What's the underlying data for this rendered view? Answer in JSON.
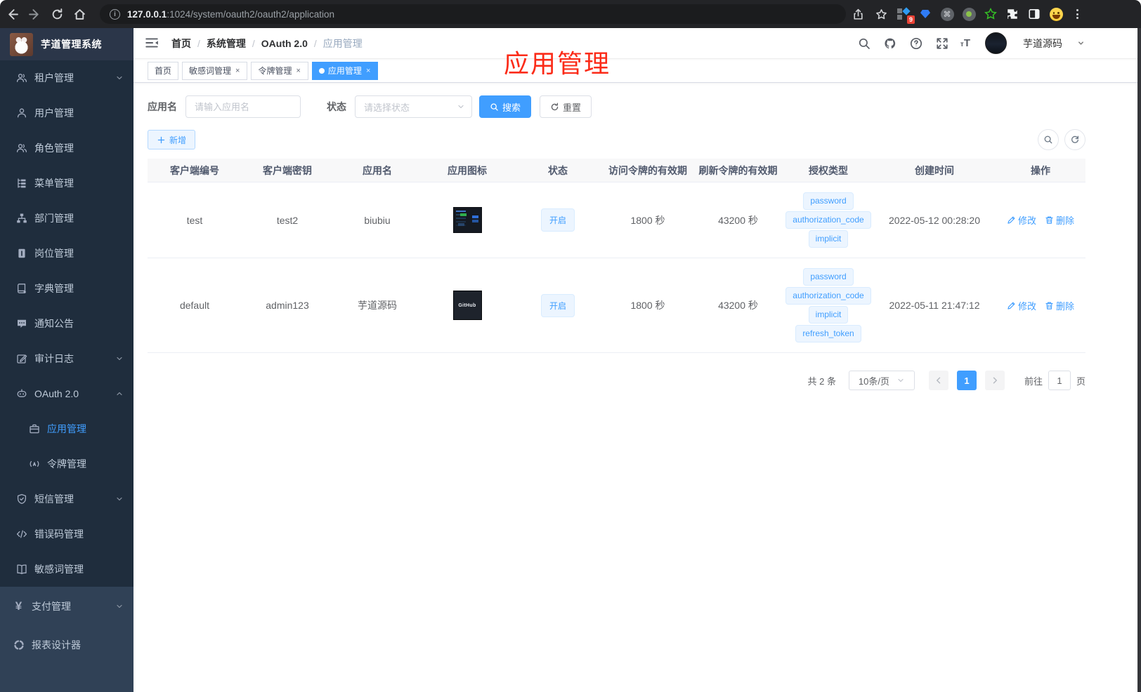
{
  "browser": {
    "url": {
      "host": "127.0.0.1",
      "rest": ":1024/system/oauth2/oauth2/application"
    },
    "extension_badge": "9"
  },
  "annotation": {
    "text": "应用管理"
  },
  "sidebar": {
    "title": "芋道管理系统",
    "groups": [
      {
        "id": "system",
        "items": [
          {
            "id": "tenant",
            "icon": "users",
            "label": "租户管理",
            "arrow": "down"
          },
          {
            "id": "user",
            "icon": "user",
            "label": "用户管理"
          },
          {
            "id": "role",
            "icon": "users",
            "label": "角色管理"
          },
          {
            "id": "menu",
            "icon": "tree",
            "label": "菜单管理"
          },
          {
            "id": "dept",
            "icon": "org",
            "label": "部门管理"
          },
          {
            "id": "post",
            "icon": "badge",
            "label": "岗位管理"
          },
          {
            "id": "dict",
            "icon": "dict",
            "label": "字典管理"
          },
          {
            "id": "notice",
            "icon": "message",
            "label": "通知公告"
          },
          {
            "id": "audit",
            "icon": "edit",
            "label": "审计日志",
            "arrow": "down"
          },
          {
            "id": "oauth2",
            "icon": "robot",
            "label": "OAuth 2.0",
            "arrow": "up"
          },
          {
            "id": "oauth2-app",
            "icon": "briefcase",
            "label": "应用管理",
            "indent": true,
            "active": true
          },
          {
            "id": "oauth2-token",
            "icon": "signal",
            "label": "令牌管理",
            "indent": true
          },
          {
            "id": "sms",
            "icon": "shield",
            "label": "短信管理",
            "arrow": "down"
          },
          {
            "id": "errcode",
            "icon": "code",
            "label": "错误码管理"
          },
          {
            "id": "sensitive",
            "icon": "book",
            "label": "敏感词管理"
          }
        ]
      },
      {
        "id": "root",
        "root": true,
        "items": [
          {
            "id": "pay",
            "icon": "yen",
            "label": "支付管理",
            "arrow": "down"
          },
          {
            "id": "report",
            "icon": "target",
            "label": "报表设计器"
          }
        ]
      }
    ]
  },
  "header": {
    "breadcrumb": [
      "首页",
      "系统管理",
      "OAuth 2.0",
      "应用管理"
    ],
    "username": "芋道源码"
  },
  "tabs": [
    {
      "label": "首页",
      "closable": false,
      "active": false
    },
    {
      "label": "敏感词管理",
      "closable": true,
      "active": false
    },
    {
      "label": "令牌管理",
      "closable": true,
      "active": false
    },
    {
      "label": "应用管理",
      "closable": true,
      "active": true
    }
  ],
  "filters": {
    "name_label": "应用名",
    "name_placeholder": "请输入应用名",
    "status_label": "状态",
    "status_placeholder": "请选择状态",
    "search_label": "搜索",
    "reset_label": "重置"
  },
  "toolbar": {
    "add_label": "新增"
  },
  "table": {
    "columns": [
      "客户端编号",
      "客户端密钥",
      "应用名",
      "应用图标",
      "状态",
      "访问令牌的有效期",
      "刷新令牌的有效期",
      "授权类型",
      "创建时间",
      "操作"
    ],
    "rows": [
      {
        "client_id": "test",
        "secret": "test2",
        "name": "biubiu",
        "icon": "dashboard",
        "status": "开启",
        "access_ttl": "1800 秒",
        "refresh_ttl": "43200 秒",
        "grants": [
          "password",
          "authorization_code",
          "implicit"
        ],
        "created": "2022-05-12 00:28:20"
      },
      {
        "client_id": "default",
        "secret": "admin123",
        "name": "芋道源码",
        "icon": "github",
        "status": "开启",
        "access_ttl": "1800 秒",
        "refresh_ttl": "43200 秒",
        "grants": [
          "password",
          "authorization_code",
          "implicit",
          "refresh_token"
        ],
        "created": "2022-05-11 21:47:12"
      }
    ],
    "actions": {
      "edit": "修改",
      "delete": "删除"
    },
    "github_thumb_text": "GitHub"
  },
  "pagination": {
    "total": "共 2 条",
    "page_size": "10条/页",
    "current": "1",
    "goto_label": "前往",
    "goto_value": "1",
    "page_unit": "页"
  },
  "colors": {
    "primary": "#409eff",
    "annotation": "#fb2b18",
    "tag_bg": "#ecf5ff",
    "tag_border": "#d9ecff"
  }
}
